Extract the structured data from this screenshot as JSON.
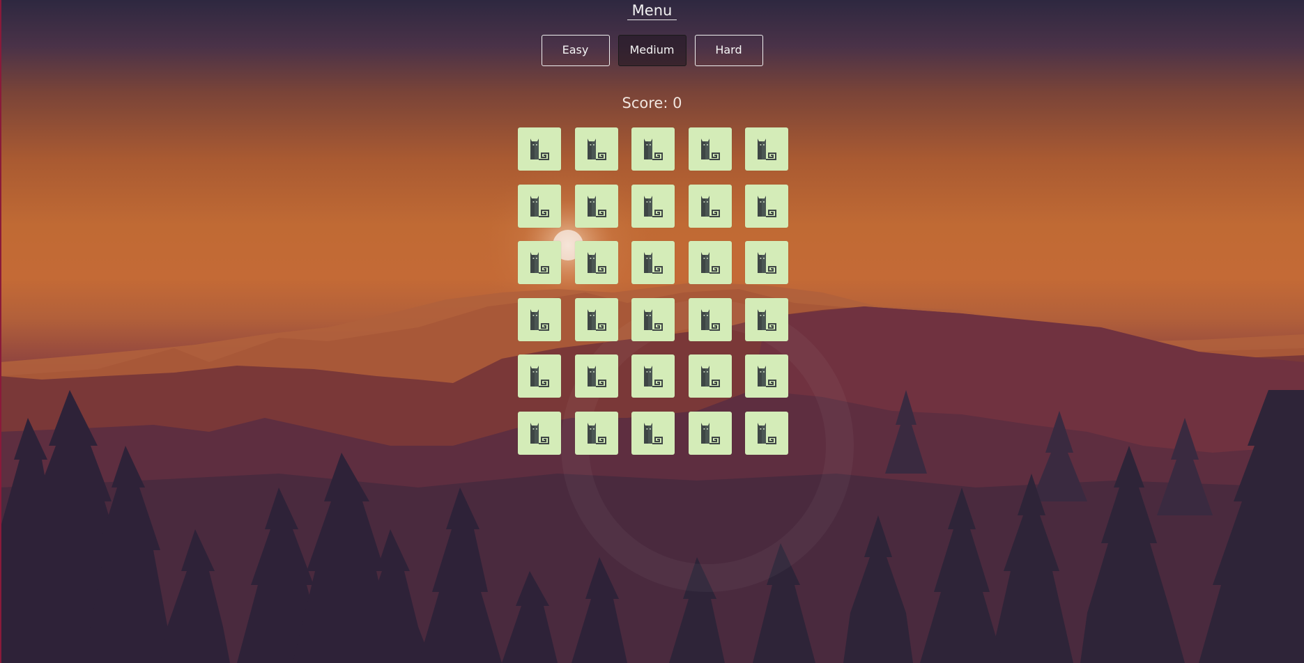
{
  "menu": {
    "title": "Menu"
  },
  "difficulty": [
    {
      "label": "Easy",
      "active": false
    },
    {
      "label": "Medium",
      "active": true
    },
    {
      "label": "Hard",
      "active": false
    }
  ],
  "score": {
    "text": "Score: 0"
  },
  "board": {
    "rows": 6,
    "cols": 5,
    "card_icon": "cat-icon",
    "card_state": "face-down"
  },
  "colors": {
    "card_bg": "#d4ecb8",
    "cat_dark": "#3e4645",
    "cat_light": "#55605e",
    "cat_eyes": "#c8d8c0"
  }
}
